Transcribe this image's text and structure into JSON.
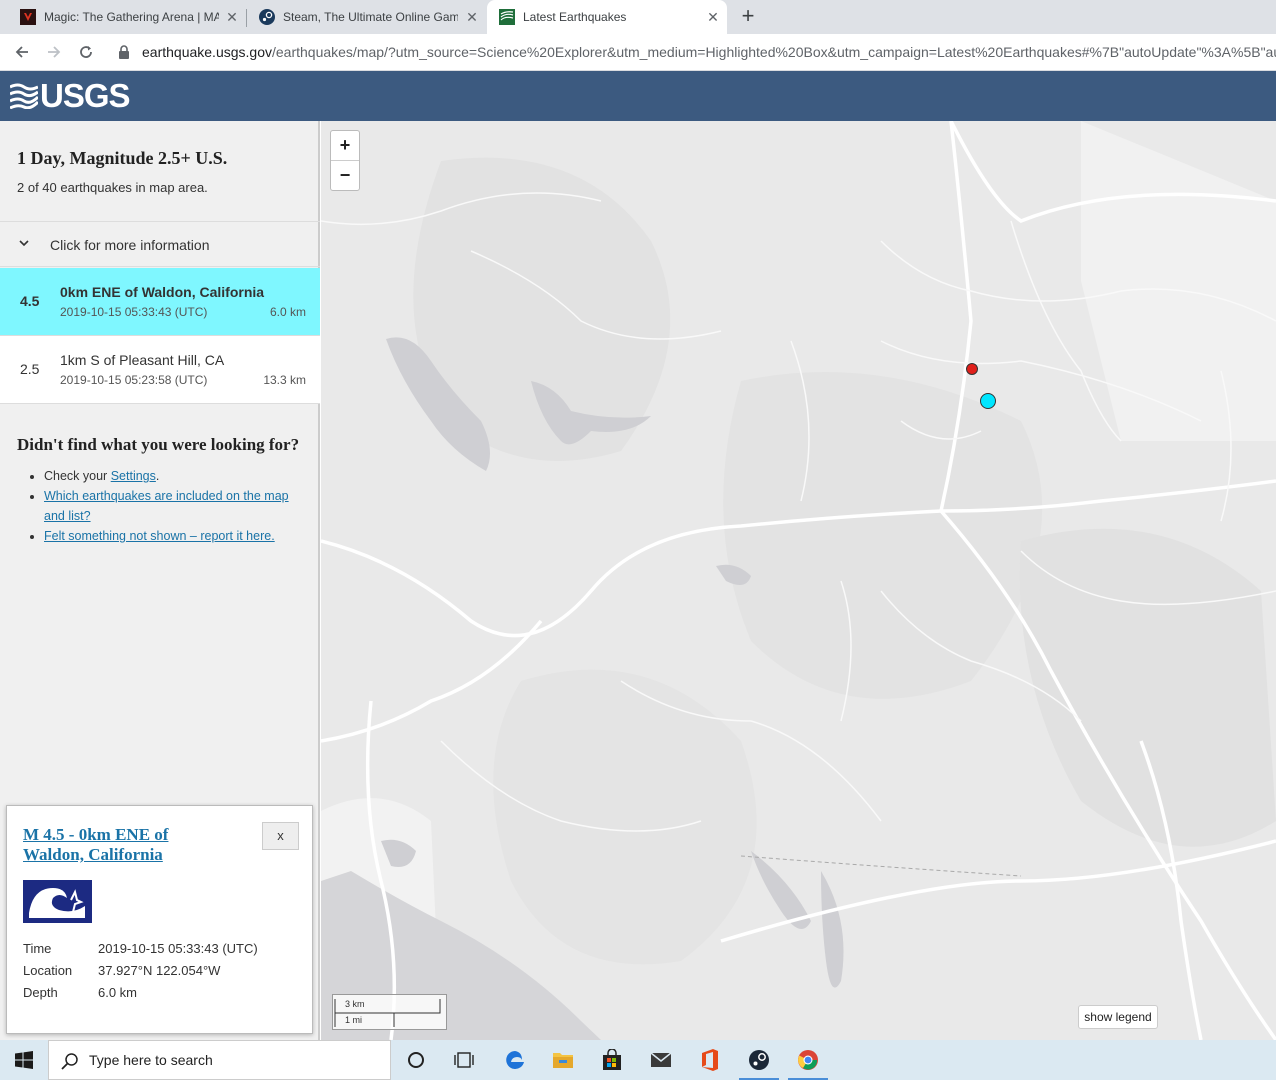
{
  "browser": {
    "tabs": [
      {
        "title": "Magic: The Gathering Arena | MA",
        "active": false,
        "icon": "mtg-icon"
      },
      {
        "title": "Steam, The Ultimate Online Gam",
        "active": false,
        "icon": "steam-icon"
      },
      {
        "title": "Latest Earthquakes",
        "active": true,
        "icon": "usgs-icon"
      }
    ],
    "close_glyph": "✕",
    "new_tab_glyph": "+",
    "url_domain": "earthquake.usgs.gov",
    "url_path": "/earthquakes/map/?utm_source=Science%20Explorer&utm_medium=Highlighted%20Box&utm_campaign=Latest%20Earthquakes#%7B\"autoUpdate\"%3A%5B\"autoUpd"
  },
  "header": {
    "logo_text": "USGS"
  },
  "sidebar": {
    "title": "1 Day, Magnitude 2.5+ U.S.",
    "subtitle": "2 of 40 earthquakes in map area.",
    "more_info": "Click for more information",
    "earthquakes": [
      {
        "mag": "4.5",
        "place": "0km ENE of Waldon, California",
        "time": "2019-10-15 05:33:43 (UTC)",
        "depth": "6.0 km",
        "selected": true
      },
      {
        "mag": "2.5",
        "place": "1km S of Pleasant Hill, CA",
        "time": "2019-10-15 05:23:58 (UTC)",
        "depth": "13.3 km",
        "selected": false
      }
    ],
    "help": {
      "heading": "Didn't find what you were looking for?",
      "check_prefix": "Check your ",
      "settings_link": "Settings",
      "check_suffix": ".",
      "link_included": "Which earthquakes are included on the map and list?",
      "link_felt": "Felt something not shown – report it here."
    }
  },
  "popup": {
    "title": "M 4.5 - 0km ENE of Waldon, California",
    "close": "x",
    "time_label": "Time",
    "time_value": "2019-10-15 05:33:43 (UTC)",
    "location_label": "Location",
    "location_value": "37.927°N 122.054°W",
    "depth_label": "Depth",
    "depth_value": "6.0 km"
  },
  "map": {
    "zoom_in": "+",
    "zoom_out": "−",
    "scale_km": "3 km",
    "scale_mi": "1 mi",
    "legend_button": "show legend",
    "markers": [
      {
        "label": "M 4.5",
        "color": "#00e6ff",
        "selected": true
      },
      {
        "label": "M 2.5",
        "color": "#e0201b",
        "selected": false
      }
    ]
  },
  "taskbar": {
    "search_placeholder": "Type here to search",
    "apps": [
      "cortana-icon",
      "task-view-icon",
      "edge-icon",
      "file-explorer-icon",
      "store-icon",
      "mail-icon",
      "office-icon",
      "steam-icon",
      "chrome-icon"
    ]
  },
  "colors": {
    "usgs_header": "#3c5a80",
    "selected_row": "#7ff7ff",
    "link": "#1a73a7"
  }
}
